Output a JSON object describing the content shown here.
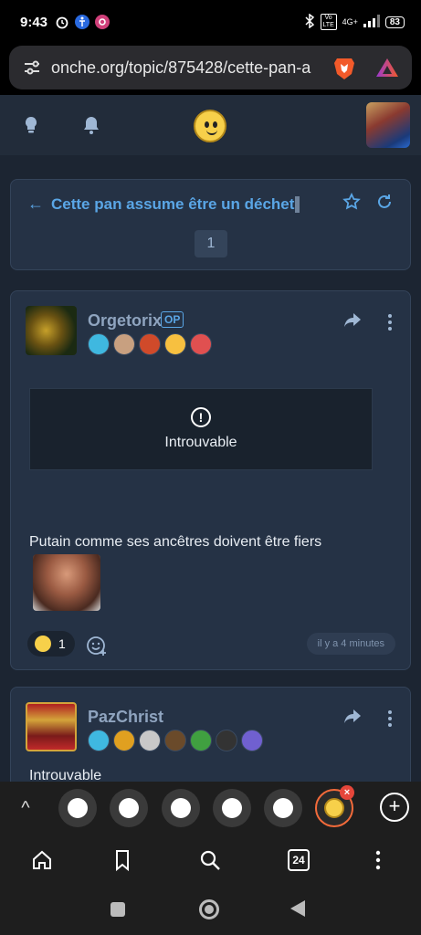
{
  "status_bar": {
    "time": "9:43",
    "network": "4G+",
    "volte": "Vo LTE",
    "battery": "83"
  },
  "browser": {
    "url": "onche.org/topic/875428/cette-pan-a"
  },
  "site": {
    "topic_title": "Cette pan assume être un déchet",
    "page_number": "1"
  },
  "posts": [
    {
      "username": "Orgetorix",
      "op_label": "OP",
      "embed_status": "Introuvable",
      "text": "Putain comme ses ancêtres doivent être fiers",
      "reaction_count": "1",
      "time_ago": "il y a 4 minutes",
      "badge_colors": [
        "#3fb8e0",
        "#c8a080",
        "#d04a2a",
        "#f7c040",
        "#e05050"
      ]
    },
    {
      "username": "PazChrist",
      "text": "Introuvable",
      "badge_colors": [
        "#3fb8e0",
        "#e0a020",
        "#c8c8c8",
        "#6a4a2a",
        "#40a040",
        "#333333",
        "#7060d0"
      ]
    }
  ],
  "tabs": {
    "open_count": "24"
  },
  "colors": {
    "accent": "#5aa6e6",
    "username": "#8fa4bf",
    "site_bg": "#1c2532",
    "card_bg": "#253245"
  }
}
